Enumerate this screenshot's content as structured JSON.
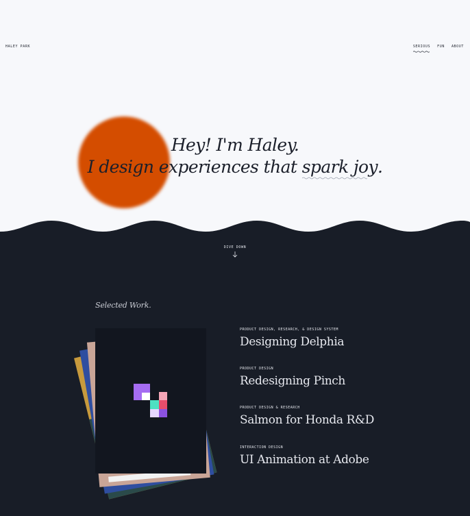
{
  "header": {
    "logo": "HALEY PARK",
    "nav": [
      {
        "label": "SERIOUS",
        "active": true
      },
      {
        "label": "FUN",
        "active": false
      },
      {
        "label": "ABOUT",
        "active": false
      }
    ]
  },
  "hero": {
    "line1": "Hey! I'm Haley.",
    "line2_prefix": "I design experiences that ",
    "line2_highlight": "spark joy",
    "line2_suffix": "."
  },
  "dive": {
    "label": "DIVE DOWN",
    "icon": "arrow-down-icon"
  },
  "work": {
    "heading": "Selected Work.",
    "projects": [
      {
        "tag": "PRODUCT DESIGN, RESEARCH, & DESIGN SYSTEM",
        "title": "Designing Delphia"
      },
      {
        "tag": "PRODUCT DESIGN",
        "title": "Redesigning Pinch"
      },
      {
        "tag": "PRODUCT DESIGN & RESEARCH",
        "title": "Salmon for Honda R&D"
      },
      {
        "tag": "INTERACTION DESIGN",
        "title": "UI Animation at Adobe"
      }
    ]
  },
  "colors": {
    "background": "#f7f8fb",
    "dark": "#181d27",
    "sun": "#d44d00",
    "text": "#1b1f2a"
  }
}
